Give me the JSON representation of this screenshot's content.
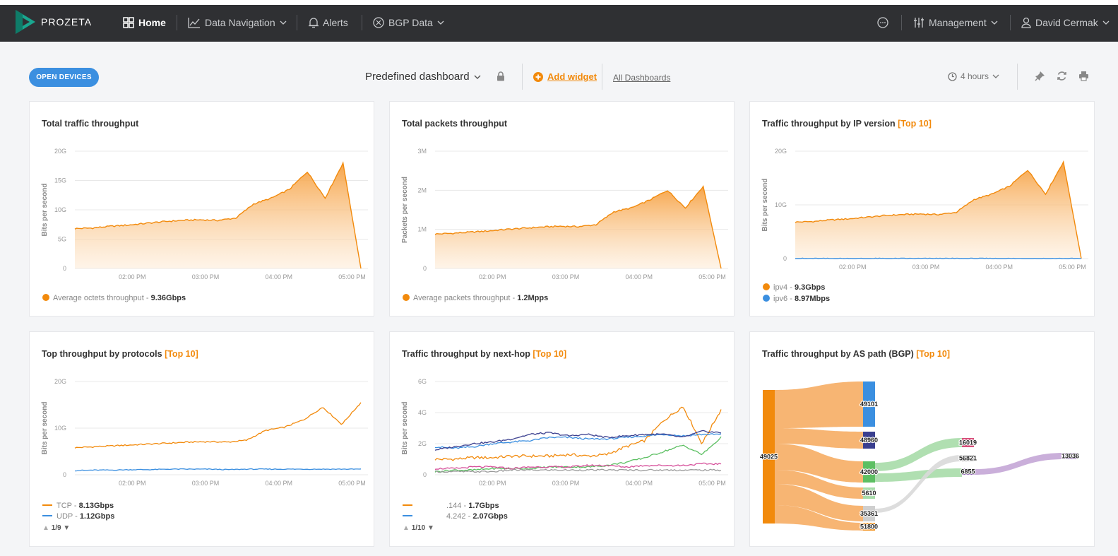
{
  "brand": {
    "name": "PROZETA"
  },
  "nav": {
    "home": "Home",
    "data_navigation": "Data Navigation",
    "alerts": "Alerts",
    "bgp_data": "BGP Data",
    "management": "Management",
    "user": "David Cermak"
  },
  "toolbar": {
    "open_devices": "OPEN DEVICES",
    "dashboard_name": "Predefined dashboard",
    "add_widget": "Add widget",
    "all_dashboards": "All Dashboards",
    "time_range": "4 hours"
  },
  "colors": {
    "orange": "#f28a0c",
    "blue": "#3b8fe0",
    "navy": "#3a3f8f",
    "green": "#5cbf62",
    "gray": "#b7b7b7"
  },
  "widgets": [
    {
      "title": "Total traffic throughput",
      "ylabel": "Bits per second",
      "legend": [
        {
          "label": "Average octets throughput",
          "value": "9.36Gbps"
        }
      ]
    },
    {
      "title": "Total packets throughput",
      "ylabel": "Packets per second",
      "legend": [
        {
          "label": "Average packets throughput",
          "value": "1.2Mpps"
        }
      ]
    },
    {
      "title": "Traffic throughput by IP version",
      "tag": "[Top 10]",
      "ylabel": "Bits per second",
      "legend": [
        {
          "label": "ipv4",
          "value": "9.3Gbps"
        },
        {
          "label": "ipv6",
          "value": "8.97Mbps"
        }
      ]
    },
    {
      "title": "Top throughput by protocols",
      "tag": "[Top 10]",
      "ylabel": "Bits per second",
      "legend": [
        {
          "label": "TCP",
          "value": "8.13Gbps"
        },
        {
          "label": "UDP",
          "value": "1.12Gbps"
        }
      ],
      "pager": "1/9"
    },
    {
      "title": "Traffic throughput by next-hop",
      "tag": "[Top 10]",
      "ylabel": "Bits per second",
      "legend": [
        {
          "label": ".144",
          "value": "1.7Gbps"
        },
        {
          "label": "4.242",
          "value": "2.07Gbps"
        }
      ],
      "pager": "1/10"
    },
    {
      "title": "Traffic throughput by AS path (BGP)",
      "tag": "[Top 10]",
      "nodes": [
        "49025",
        "49101",
        "48960",
        "42000",
        "5610",
        "35361",
        "51800",
        "16019",
        "56821",
        "6855",
        "13036"
      ]
    }
  ],
  "chart_data": [
    {
      "type": "area",
      "title": "Total traffic throughput",
      "ylabel": "Bits per second",
      "y_ticks": [
        "0",
        "5G",
        "10G",
        "15G",
        "20G"
      ],
      "ylim": [
        0,
        20
      ],
      "x_ticks": [
        "02:00 PM",
        "03:00 PM",
        "04:00 PM",
        "05:00 PM"
      ],
      "series": [
        {
          "name": "Average octets throughput",
          "values": [
            6.8,
            6.9,
            7.2,
            7.4,
            7.7,
            8.0,
            8.2,
            8.3,
            8.2,
            8.6,
            11.0,
            12.0,
            13.5,
            16.5,
            12.0,
            18.0,
            0
          ]
        }
      ]
    },
    {
      "type": "area",
      "title": "Total packets throughput",
      "ylabel": "Packets per second",
      "y_ticks": [
        "0",
        "1M",
        "2M",
        "3M"
      ],
      "ylim": [
        0,
        3
      ],
      "x_ticks": [
        "02:00 PM",
        "03:00 PM",
        "04:00 PM",
        "05:00 PM"
      ],
      "series": [
        {
          "name": "Average packets throughput",
          "values": [
            0.88,
            0.9,
            0.93,
            0.96,
            1.0,
            1.03,
            1.06,
            1.08,
            1.07,
            1.12,
            1.45,
            1.55,
            1.75,
            2.0,
            1.55,
            2.1,
            0
          ]
        }
      ]
    },
    {
      "type": "area",
      "title": "Traffic throughput by IP version",
      "ylabel": "Bits per second",
      "y_ticks": [
        "0",
        "10G",
        "20G"
      ],
      "ylim": [
        0,
        20
      ],
      "x_ticks": [
        "02:00 PM",
        "03:00 PM",
        "04:00 PM",
        "05:00 PM"
      ],
      "series": [
        {
          "name": "ipv4",
          "values": [
            6.8,
            6.9,
            7.2,
            7.4,
            7.7,
            8.0,
            8.2,
            8.3,
            8.2,
            8.6,
            11.0,
            12.0,
            13.5,
            16.5,
            12.0,
            18.0,
            0
          ]
        },
        {
          "name": "ipv6",
          "values": [
            0.01,
            0.01,
            0.01,
            0.01,
            0.01,
            0.01,
            0.01,
            0.01,
            0.01,
            0.01,
            0.01,
            0.01,
            0.01,
            0.01,
            0.01,
            0.01,
            0.01
          ]
        }
      ]
    },
    {
      "type": "line",
      "title": "Top throughput by protocols",
      "ylabel": "Bits per second",
      "y_ticks": [
        "0",
        "10G",
        "20G"
      ],
      "ylim": [
        0,
        20
      ],
      "x_ticks": [
        "02:00 PM",
        "03:00 PM",
        "04:00 PM",
        "05:00 PM"
      ],
      "series": [
        {
          "name": "TCP",
          "values": [
            5.8,
            6.0,
            6.2,
            6.4,
            6.6,
            6.8,
            7.0,
            7.1,
            7.0,
            7.4,
            9.5,
            10.2,
            11.8,
            14.5,
            10.8,
            15.5
          ]
        },
        {
          "name": "UDP",
          "values": [
            0.9,
            1.0,
            1.0,
            1.1,
            1.1,
            1.2,
            1.2,
            1.2,
            1.1,
            1.2,
            1.2,
            1.2,
            1.2,
            1.2,
            1.2,
            1.2
          ]
        }
      ]
    },
    {
      "type": "line",
      "title": "Traffic throughput by next-hop",
      "ylabel": "Bits per second",
      "y_ticks": [
        "0",
        "2G",
        "4G",
        "6G"
      ],
      "ylim": [
        0,
        6
      ],
      "x_ticks": [
        "02:00 PM",
        "03:00 PM",
        "04:00 PM",
        "05:00 PM"
      ],
      "series": [
        {
          "name": ".144",
          "values": [
            1.0,
            1.0,
            1.1,
            1.1,
            1.2,
            1.2,
            1.2,
            1.3,
            1.2,
            1.3,
            1.8,
            2.2,
            3.5,
            4.4,
            2.0,
            4.2
          ]
        },
        {
          "name": "4.242",
          "values": [
            1.8,
            1.7,
            1.8,
            2.0,
            2.1,
            2.2,
            2.4,
            2.4,
            2.3,
            2.3,
            2.4,
            2.5,
            2.6,
            2.5,
            2.6,
            2.6
          ]
        },
        {
          "values": [
            1.6,
            1.8,
            2.0,
            2.1,
            2.3,
            2.6,
            2.7,
            2.5,
            2.6,
            2.4,
            2.5,
            2.6,
            2.6,
            2.4,
            2.8,
            2.7
          ]
        },
        {
          "values": [
            0.2,
            0.3,
            0.3,
            0.4,
            0.4,
            0.4,
            0.5,
            0.5,
            0.5,
            0.6,
            0.8,
            1.1,
            1.5,
            1.9,
            1.3,
            2.4
          ]
        },
        {
          "values": [
            0.4,
            0.4,
            0.5,
            0.5,
            0.4,
            0.5,
            0.5,
            0.5,
            0.6,
            0.6,
            0.5,
            0.6,
            0.6,
            0.6,
            0.7,
            0.7
          ]
        },
        {
          "values": [
            0.2,
            0.2,
            0.2,
            0.2,
            0.3,
            0.3,
            0.3,
            0.3,
            0.3,
            0.3,
            0.3,
            0.3,
            0.3,
            0.3,
            0.3,
            0.3
          ]
        }
      ]
    }
  ]
}
